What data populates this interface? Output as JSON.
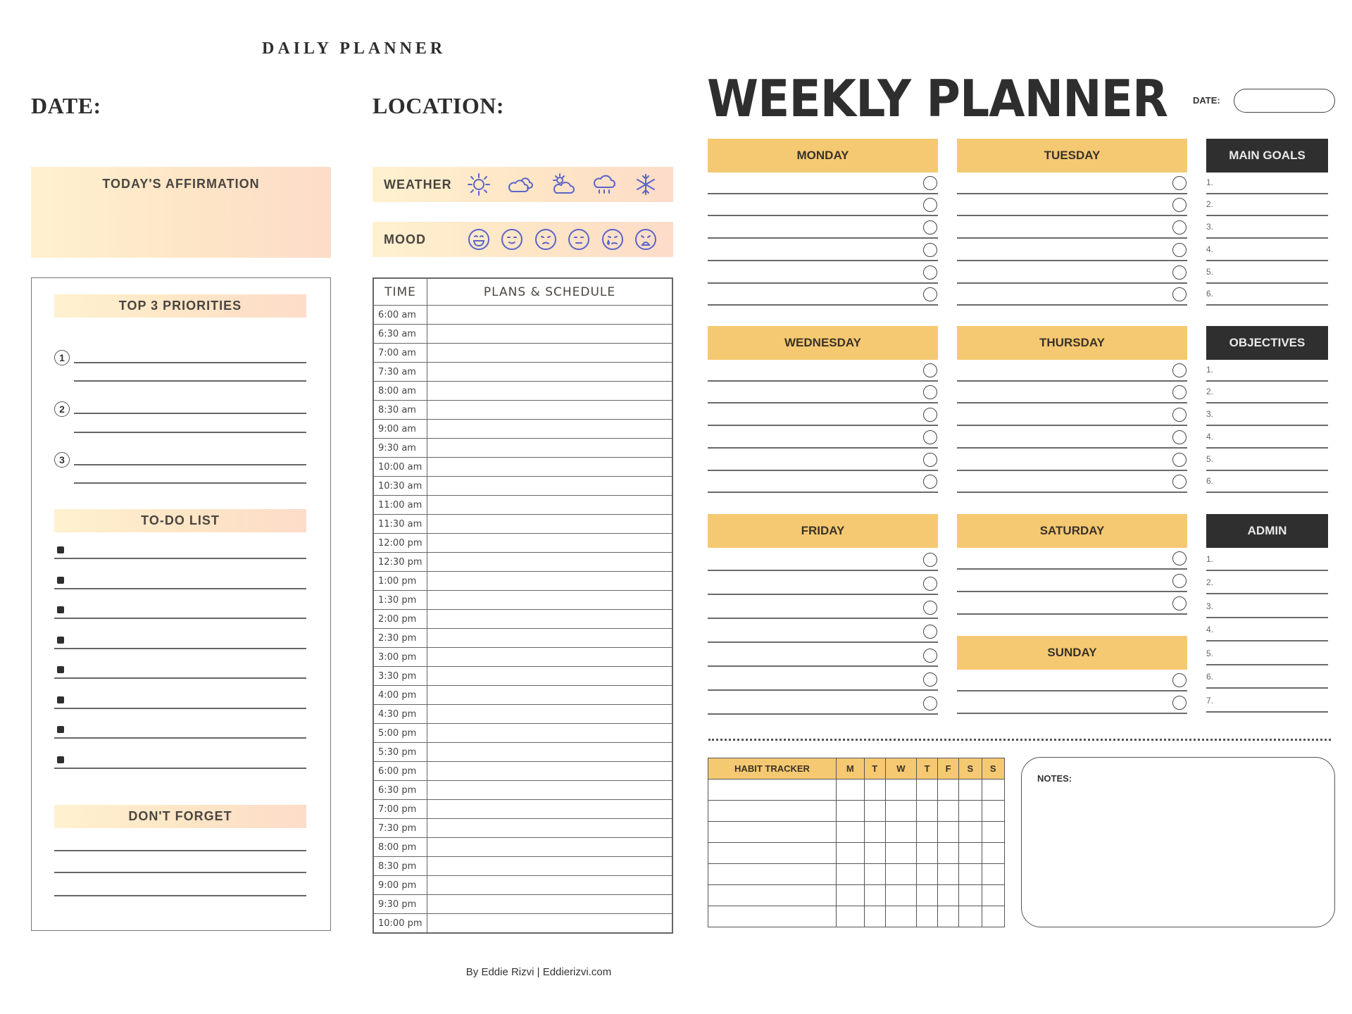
{
  "daily": {
    "title": "DAILY PLANNER",
    "date_label": "DATE:",
    "location_label": "LOCATION:",
    "affirmation_label": "TODAY'S AFFIRMATION",
    "weather_label": "WEATHER",
    "weather_icons": [
      "sun-icon",
      "cloudy-icon",
      "partly-cloudy-icon",
      "rain-icon",
      "snowflake-icon"
    ],
    "mood_label": "MOOD",
    "mood_icons": [
      "laughing-face-icon",
      "content-face-icon",
      "sad-face-icon",
      "neutral-face-icon",
      "crying-face-icon",
      "distressed-face-icon"
    ],
    "icon_color": "#5b63c9",
    "priorities_label": "TOP 3 PRIORITIES",
    "priority_numbers": [
      "1",
      "2",
      "3"
    ],
    "todo_label": "TO-DO LIST",
    "todo_count": 8,
    "dont_forget_label": "DON'T FORGET",
    "schedule": {
      "time_header": "TIME",
      "plans_header": "PLANS & SCHEDULE",
      "times": [
        "6:00 am",
        "6:30 am",
        "7:00 am",
        "7:30 am",
        "8:00 am",
        "8:30 am",
        "9:00 am",
        "9:30 am",
        "10:00 am",
        "10:30 am",
        "11:00 am",
        "11:30 am",
        "12:00 pm",
        "12:30 pm",
        "1:00 pm",
        "1:30 pm",
        "2:00 pm",
        "2:30 pm",
        "3:00 pm",
        "3:30 pm",
        "4:00 pm",
        "4:30 pm",
        "5:00 pm",
        "5:30 pm",
        "6:00 pm",
        "6:30 pm",
        "7:00 pm",
        "7:30 pm",
        "8:00 pm",
        "8:30 pm",
        "9:00 pm",
        "9:30 pm",
        "10:00 pm"
      ]
    }
  },
  "weekly": {
    "title": "WEEKLY PLANNER",
    "date_label": "DATE:",
    "days": {
      "monday": "MONDAY",
      "tuesday": "TUESDAY",
      "wednesday": "WEDNESDAY",
      "thursday": "THURSDAY",
      "friday": "FRIDAY",
      "saturday": "SATURDAY",
      "sunday": "SUNDAY"
    },
    "main_goals": {
      "label": "MAIN GOALS",
      "items": [
        "1.",
        "2.",
        "3.",
        "4.",
        "5.",
        "6."
      ]
    },
    "objectives": {
      "label": "OBJECTIVES",
      "items": [
        "1.",
        "2.",
        "3.",
        "4.",
        "5.",
        "6."
      ]
    },
    "admin": {
      "label": "ADMIN",
      "items": [
        "1.",
        "2.",
        "3.",
        "4.",
        "5.",
        "6.",
        "7."
      ]
    },
    "habit_tracker": {
      "label": "HABIT TRACKER",
      "day_headers": [
        "M",
        "T",
        "W",
        "T",
        "F",
        "S",
        "S"
      ],
      "row_count": 7
    },
    "notes_label": "NOTES:",
    "accent_color": "#f5c972",
    "dark_color": "#2f2f2f"
  },
  "footer": "By Eddie Rizvi  |  Eddierizvi.com"
}
